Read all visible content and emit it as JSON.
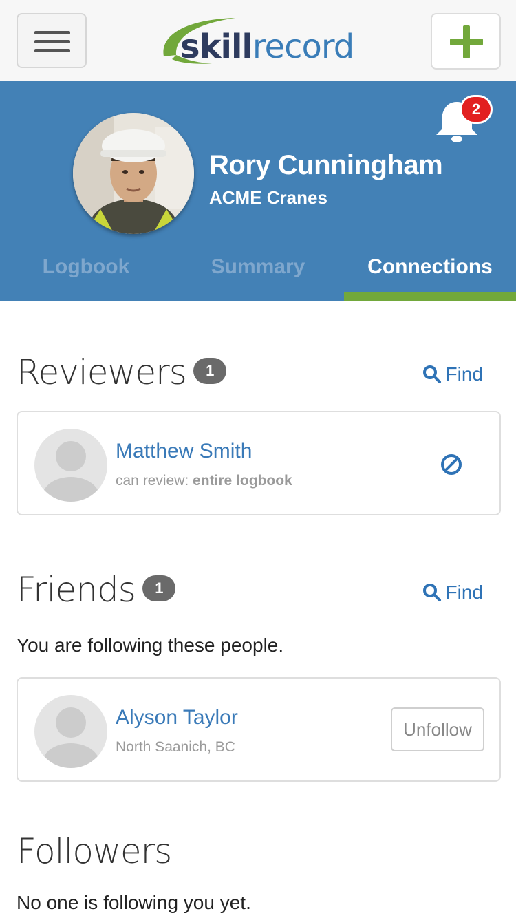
{
  "header": {
    "logo": {
      "part1": "skill",
      "part2": "record"
    },
    "menu_icon": "hamburger-menu-icon",
    "add_icon": "plus-icon",
    "colors": {
      "brand_green": "#72a83b",
      "brand_navy": "#2e3b5e",
      "brand_blue": "#3a7db8"
    }
  },
  "profile": {
    "name": "Rory Cunningham",
    "company": "ACME Cranes",
    "notifications_count": "2",
    "background": "#4381b6"
  },
  "tabs": [
    {
      "label": "Logbook",
      "active": false
    },
    {
      "label": "Summary",
      "active": false
    },
    {
      "label": "Connections",
      "active": true
    }
  ],
  "reviewers": {
    "title": "Reviewers",
    "count": "1",
    "find_label": "Find",
    "items": [
      {
        "name": "Matthew Smith",
        "sub_prefix": "can review: ",
        "sub_value": "entire logbook",
        "action_icon": "revoke-icon"
      }
    ]
  },
  "friends": {
    "title": "Friends",
    "count": "1",
    "find_label": "Find",
    "description": "You are following these people.",
    "items": [
      {
        "name": "Alyson Taylor",
        "location": "North Saanich, BC",
        "action_label": "Unfollow"
      }
    ]
  },
  "followers": {
    "title": "Followers",
    "description": "No one is following you yet."
  }
}
